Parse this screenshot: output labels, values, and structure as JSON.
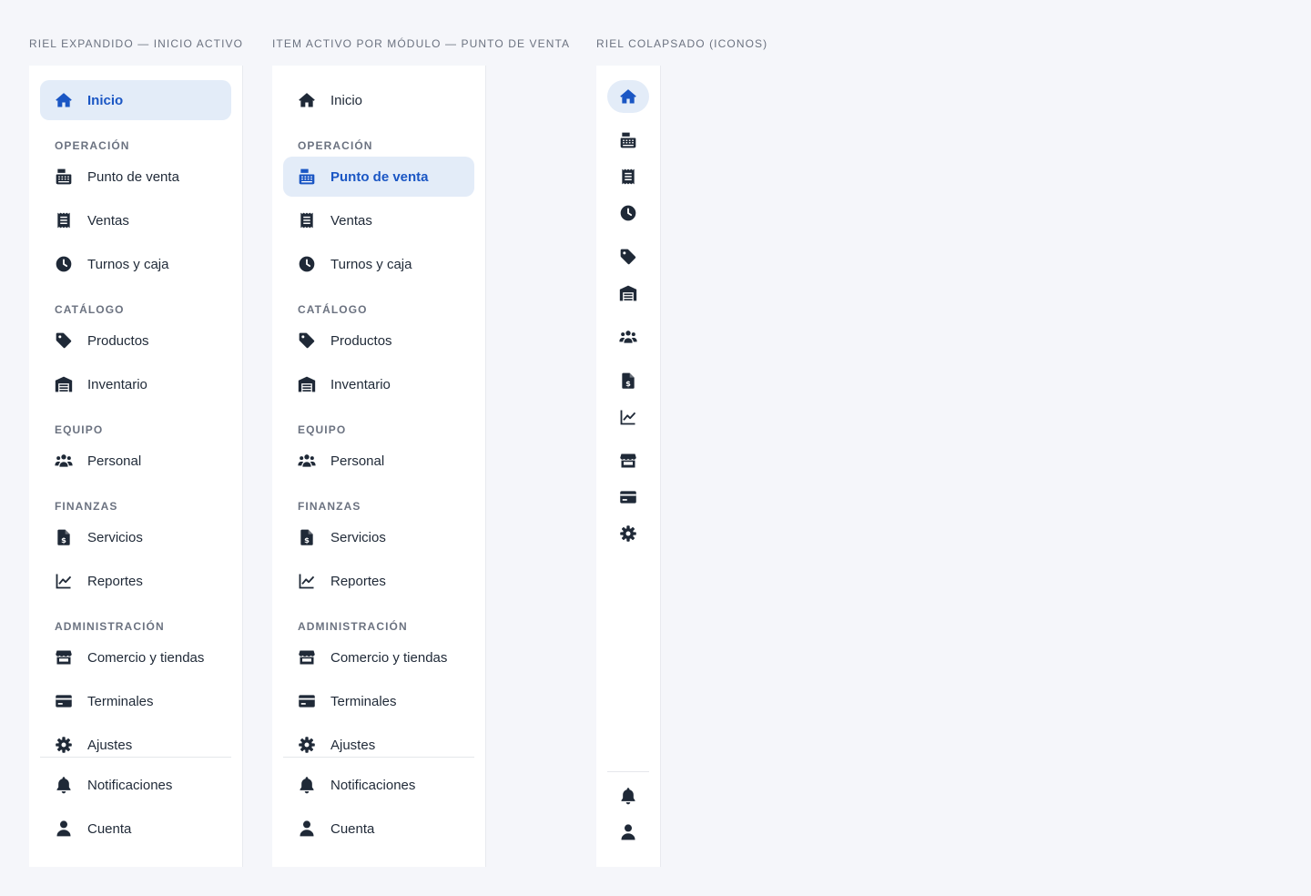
{
  "captions": {
    "expanded": "RIEL EXPANDIDO — INICIO ACTIVO",
    "module": "ITEM ACTIVO POR MÓDULO — PUNTO DE VENTA",
    "collapsed": "RIEL COLAPSADO (ICONOS)"
  },
  "nav": {
    "inicio": "Inicio",
    "sections": {
      "operacion": "OPERACIÓN",
      "catalogo": "CATÁLOGO",
      "equipo": "EQUIPO",
      "finanzas": "FINANZAS",
      "administracion": "ADMINISTRACIÓN"
    },
    "items": {
      "punto_de_venta": "Punto de venta",
      "ventas": "Ventas",
      "turnos_y_caja": "Turnos y caja",
      "productos": "Productos",
      "inventario": "Inventario",
      "personal": "Personal",
      "servicios": "Servicios",
      "reportes": "Reportes",
      "comercio_y_tiendas": "Comercio y tiendas",
      "terminales": "Terminales",
      "ajustes": "Ajustes"
    },
    "footer": {
      "notificaciones": "Notificaciones",
      "cuenta": "Cuenta"
    }
  },
  "active": {
    "expanded_rail": "Inicio",
    "module_rail": "Punto de venta",
    "collapsed_rail": "Inicio"
  },
  "icons": {
    "inicio": "home-icon",
    "punto_de_venta": "cash-register-icon",
    "ventas": "receipt-icon",
    "turnos_y_caja": "clock-icon",
    "productos": "tag-icon",
    "inventario": "warehouse-icon",
    "personal": "users-icon",
    "servicios": "invoice-dollar-icon",
    "reportes": "chart-line-icon",
    "comercio_y_tiendas": "store-icon",
    "terminales": "credit-card-icon",
    "ajustes": "gear-icon",
    "notificaciones": "bell-icon",
    "cuenta": "user-icon"
  },
  "colors": {
    "accent": "#1a56c4",
    "active_bg": "#e3ecf8",
    "text": "#1f2937",
    "muted": "#6b7280",
    "page_bg": "#f5f6fa"
  }
}
